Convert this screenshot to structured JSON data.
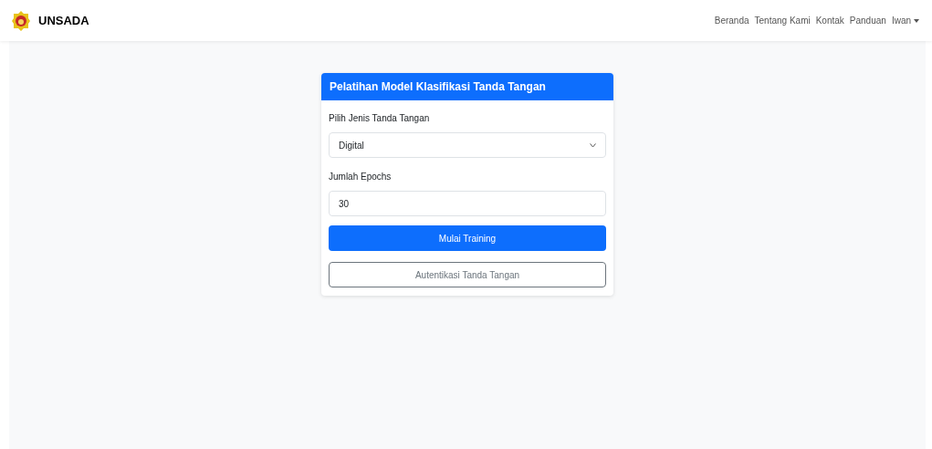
{
  "navbar": {
    "brand": "UNSADA",
    "links": [
      {
        "label": "Beranda",
        "kind": "link"
      },
      {
        "label": "Tentang Kami",
        "kind": "link"
      },
      {
        "label": "Kontak",
        "kind": "link"
      },
      {
        "label": "Panduan",
        "kind": "link"
      },
      {
        "label": "Iwan",
        "kind": "dropdown"
      }
    ]
  },
  "card": {
    "title": "Pelatihan Model Klasifikasi Tanda Tangan",
    "select": {
      "label": "Pilih Jenis Tanda Tangan",
      "value": "Digital"
    },
    "epochs": {
      "label": "Jumlah Epochs",
      "value": "30"
    },
    "buttons": [
      {
        "label": "Mulai Training",
        "kind": "primary"
      },
      {
        "label": "Autentikasi Tanda Tangan",
        "kind": "outline"
      }
    ]
  }
}
